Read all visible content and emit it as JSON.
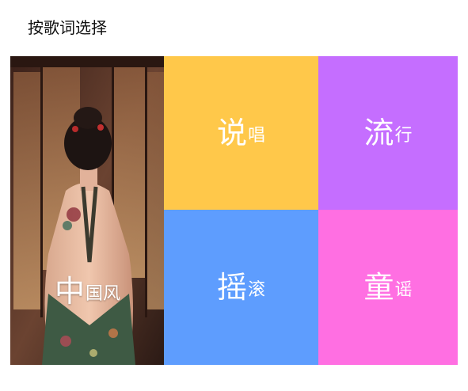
{
  "header": {
    "title": "按歌词选择"
  },
  "tiles": {
    "chinese": {
      "big": "中",
      "small": "国风",
      "icon": "portrait-photo"
    },
    "rap": {
      "big": "说",
      "small": "唱",
      "color": "#FFC84A"
    },
    "pop": {
      "big": "流",
      "small": "行",
      "color": "#C56EFF"
    },
    "rock": {
      "big": "摇",
      "small": "滚",
      "color": "#5E9DFE"
    },
    "kids": {
      "big": "童",
      "small": "谣",
      "color": "#FF6FE2"
    }
  }
}
